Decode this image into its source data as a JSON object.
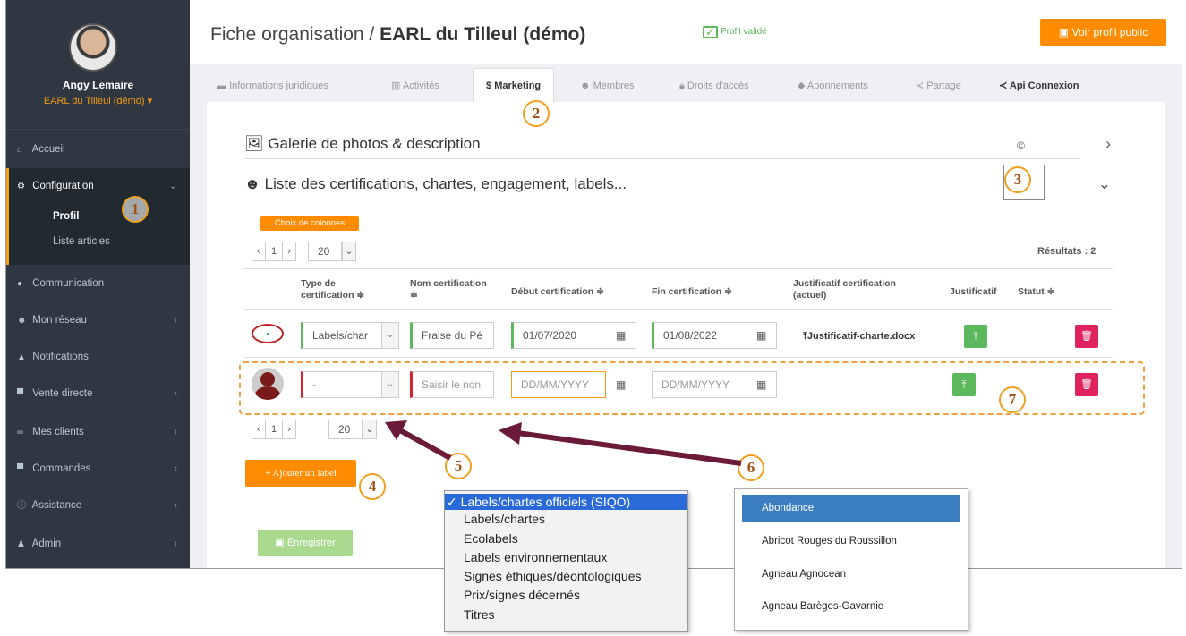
{
  "user": {
    "name": "Angy Lemaire",
    "org": "EARL du Tilleul (démo) ▾"
  },
  "nav": {
    "accueil": "Accueil",
    "configuration": "Configuration",
    "profil": "Profil",
    "liste_articles": "Liste articles",
    "communication": "Communication",
    "mon_reseau": "Mon réseau",
    "notifications": "Notifications",
    "vente_directe": "Vente directe",
    "mes_clients": "Mes clients",
    "commandes": "Commandes",
    "assistance": "Assistance",
    "admin": "Admin"
  },
  "header": {
    "title_prefix": "Fiche organisation / ",
    "title_org": "EARL du Tilleul (démo)",
    "status": "Profil validé",
    "public_btn": "Voir profil public"
  },
  "tabs": {
    "juridique": "Informations juridiques",
    "activites": "Activités",
    "marketing": "Marketing",
    "membres": "Membres",
    "droits": "Droits d'accès",
    "abonnements": "Abonnements",
    "partage": "Partage",
    "api": "Api Connexion"
  },
  "sections": {
    "gallery": "Galerie de photos & description",
    "certif": "Liste des certifications, chartes, engagement, labels..."
  },
  "table": {
    "columns_btn": "Choix de colonnes",
    "page": "1",
    "per_page": "20",
    "results": "Résultats : 2",
    "headers": {
      "type": "Type de certification ≑",
      "nom": "Nom certification ≑",
      "debut": "Début certification ≑",
      "fin": "Fin certification ≑",
      "justif_actuel": "Justificatif certification (actuel)",
      "justif": "Justificatif",
      "statut": "Statut ≑"
    },
    "rows": [
      {
        "type": "Labels/char",
        "nom": "Fraise du Pé",
        "debut": "01/07/2020",
        "fin": "01/08/2022",
        "file": "Justificatif-charte.docx"
      },
      {
        "type": "-",
        "nom_placeholder": "Saisir le non",
        "debut_placeholder": "DD/MM/YYYY",
        "fin_placeholder": "DD/MM/YYYY"
      }
    ]
  },
  "buttons": {
    "add_label": "+ Ajouter un label",
    "save": "Enregistrer"
  },
  "type_options": {
    "selected": "✓ Labels/chartes officiels (SIQO)",
    "items": [
      "Labels/chartes",
      "Ecolabels",
      "Labels environnementaux",
      "Signes éthiques/déontologiques",
      "Prix/signes décernés",
      "Titres"
    ]
  },
  "name_options": {
    "selected": "Abondance",
    "items": [
      "Abricot Rouges du Roussillon",
      "Agneau Agnocean",
      "Agneau Barèges-Gavarnie"
    ]
  },
  "callouts": [
    "1",
    "2",
    "3",
    "4",
    "5",
    "6",
    "7"
  ],
  "colors": {
    "accent": "#ff8c00",
    "sidebar": "#2f3742",
    "success": "#5cb85c",
    "danger": "#e0245e",
    "arrow": "#6b1a3a"
  }
}
